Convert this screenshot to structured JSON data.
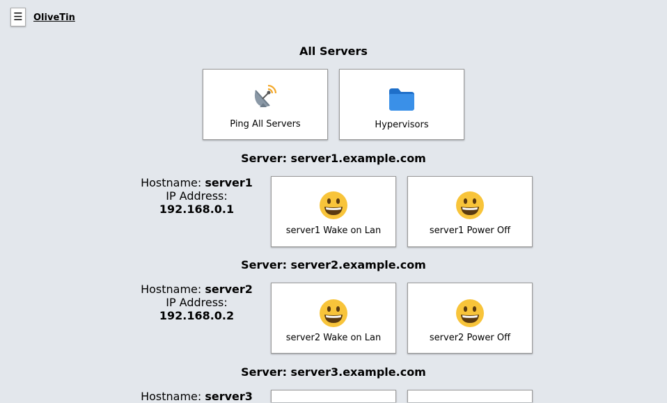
{
  "app": {
    "menu_icon_glyph": "☰",
    "title": "OliveTin"
  },
  "all_servers": {
    "title": "All Servers",
    "actions": [
      {
        "label": "Ping All Servers",
        "icon": "satellite-dish-icon"
      },
      {
        "label": "Hypervisors",
        "icon": "folder-icon"
      }
    ]
  },
  "servers": [
    {
      "title": "Server: server1.example.com",
      "hostname_label": "Hostname:",
      "hostname": "server1",
      "ip_label": "IP Address:",
      "ip": "192.168.0.1",
      "actions": [
        {
          "label": "server1 Wake on Lan",
          "icon": "smile-icon"
        },
        {
          "label": "server1 Power Off",
          "icon": "smile-icon"
        }
      ]
    },
    {
      "title": "Server: server2.example.com",
      "hostname_label": "Hostname:",
      "hostname": "server2",
      "ip_label": "IP Address:",
      "ip": "192.168.0.2",
      "actions": [
        {
          "label": "server2 Wake on Lan",
          "icon": "smile-icon"
        },
        {
          "label": "server2 Power Off",
          "icon": "smile-icon"
        }
      ]
    },
    {
      "title": "Server: server3.example.com",
      "hostname_label": "Hostname:",
      "hostname": "server3"
    }
  ],
  "colors": {
    "background": "#e3e7ec",
    "folder": "#2f88e6",
    "smile_face": "#f8c43a"
  }
}
